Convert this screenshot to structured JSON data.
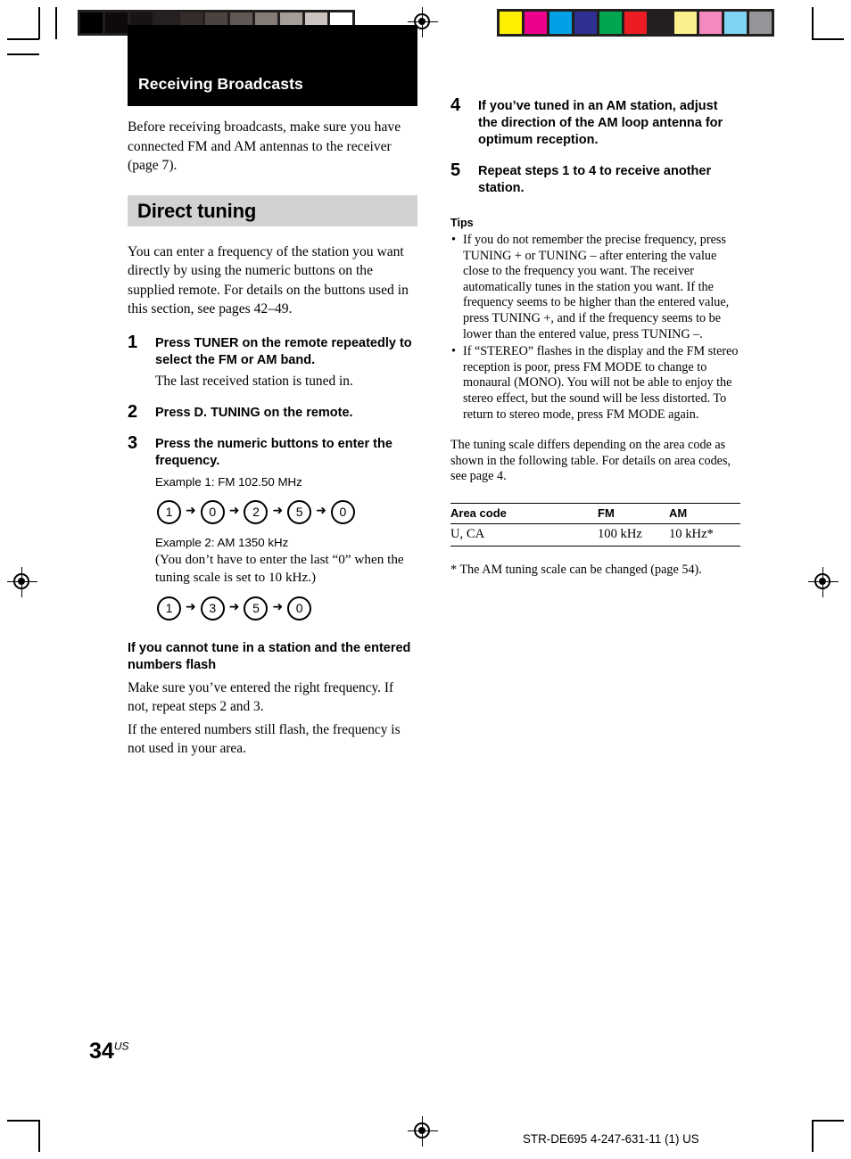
{
  "document": {
    "chapter_title": "Receiving Broadcasts",
    "page_number": "34",
    "page_number_suffix": "US",
    "model_footer": "STR-DE695 4-247-631-11 (1) US"
  },
  "left_column": {
    "intro": "Before receiving broadcasts, make sure you have connected FM and AM antennas to the receiver (page 7).",
    "section_heading": "Direct tuning",
    "section_intro": "You can enter a frequency of the station you want directly by using the numeric buttons on the supplied remote. For details on the buttons used in this section, see pages 42–49.",
    "steps": [
      {
        "number": "1",
        "title": "Press TUNER on the remote repeatedly to select the FM or AM band.",
        "note": "The last received station is tuned in."
      },
      {
        "number": "2",
        "title": "Press D. TUNING on the remote."
      },
      {
        "number": "3",
        "title": "Press the numeric buttons to enter the frequency.",
        "example1_label": "Example 1:  FM 102.50 MHz",
        "example1_keys": [
          "1",
          "0",
          "2",
          "5",
          "0"
        ],
        "example2_label": "Example 2:  AM 1350 kHz",
        "example2_note": "(You don’t have to enter the last “0” when the tuning scale is set to 10 kHz.)",
        "example2_keys": [
          "1",
          "3",
          "5",
          "0"
        ]
      }
    ],
    "troubleshooting": {
      "heading": "If you cannot tune in a station and the entered numbers flash",
      "para1": "Make sure you’ve entered the right frequency. If not, repeat steps 2 and 3.",
      "para2": "If the entered numbers still flash, the frequency is not used in your area."
    }
  },
  "right_column": {
    "steps": [
      {
        "number": "4",
        "title": "If you’ve tuned in an AM station, adjust the direction of the AM loop antenna for optimum reception."
      },
      {
        "number": "5",
        "title": "Repeat steps 1 to 4 to receive another station."
      }
    ],
    "tips_heading": "Tips",
    "tips": [
      "If you do not remember the precise frequency, press TUNING + or TUNING – after entering the value close to the frequency you want. The receiver automatically tunes in the station you want. If the frequency seems to be higher than the entered value, press TUNING +, and if the frequency seems to be lower than the entered value, press TUNING –.",
      "If “STEREO” flashes in the display and the FM stereo reception is poor, press FM MODE to change to monaural (MONO). You will not be able to enjoy the stereo effect, but the sound will be less distorted. To return to stereo mode, press FM MODE again."
    ],
    "table_intro": "The tuning scale differs depending on the area code as shown in the following table. For details on area codes, see page 4.",
    "table": {
      "headers": [
        "Area code",
        "FM",
        "AM"
      ],
      "rows": [
        [
          "U, CA",
          "100 kHz",
          "10 kHz*"
        ]
      ]
    },
    "footnote": "* The AM tuning scale can be changed (page 54)."
  },
  "print_marks": {
    "grayscale_swatches": [
      "#000000",
      "#0d0a09",
      "#191413",
      "#262020",
      "#332c2b",
      "#4c4340",
      "#615754",
      "#857b77",
      "#a69d99",
      "#cbc4c1",
      "#ffffff"
    ],
    "color_swatches": [
      "#fff000",
      "#ec008c",
      "#00a0e4",
      "#2e3192",
      "#00a651",
      "#ed1c24",
      "#231f20",
      "#fbf18c",
      "#f489bd",
      "#7fd4f4",
      "#939598"
    ]
  }
}
